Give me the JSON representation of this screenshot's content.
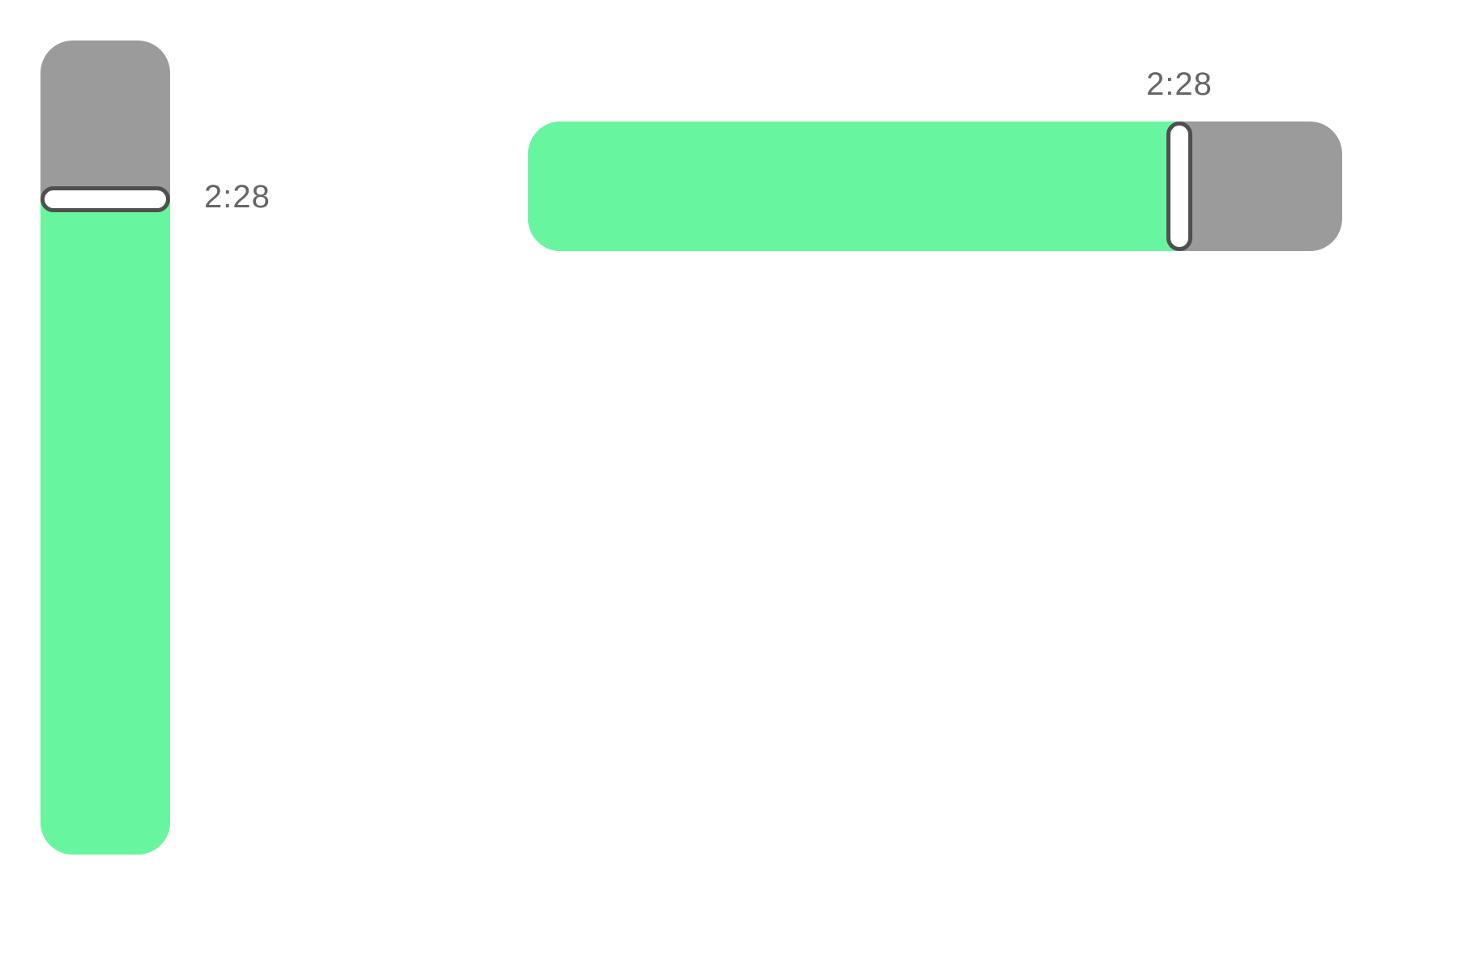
{
  "colors": {
    "fill": "#67f69f",
    "track": "#9b9b9b",
    "thumb_border": "#4f4f4f",
    "label": "#666666"
  },
  "vertical_slider": {
    "value_fraction": 0.805,
    "time_label": "2:28"
  },
  "horizontal_slider": {
    "value_fraction": 0.8,
    "time_label": "2:28"
  }
}
